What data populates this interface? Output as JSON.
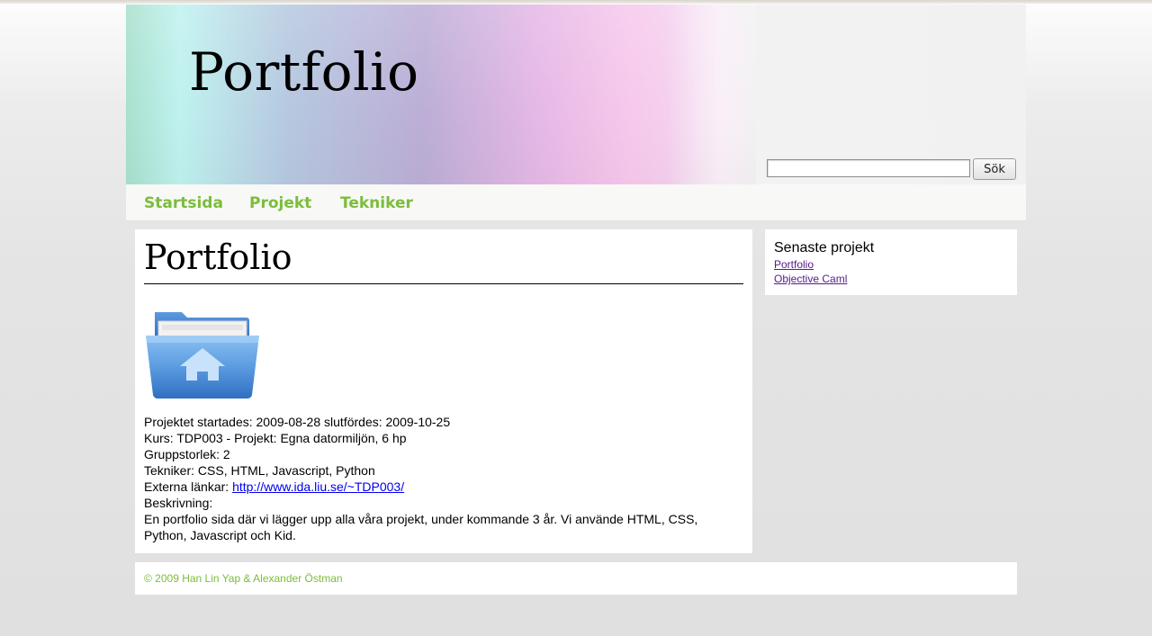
{
  "header": {
    "title": "Portfolio",
    "search": {
      "value": "",
      "placeholder": ""
    },
    "search_button": "Sök"
  },
  "nav": {
    "items": [
      {
        "label": "Startsida"
      },
      {
        "label": "Projekt"
      },
      {
        "label": "Tekniker"
      }
    ]
  },
  "main": {
    "heading": "Portfolio",
    "image_icon": "folder-home-icon",
    "info": {
      "started_label": "Projektet startades:",
      "started": "2009-08-28",
      "finished_label": "slutfördes:",
      "finished": "2009-10-25",
      "course": "Kurs: TDP003 - Projekt: Egna datormiljön, 6 hp",
      "group_size": "Gruppstorlek: 2",
      "techniques": "Tekniker: CSS, HTML, Javascript, Python",
      "external_label": "Externa länkar:",
      "external_link": "http://www.ida.liu.se/~TDP003/",
      "description_label": "Beskrivning:",
      "description": "En portfolio sida där vi lägger upp alla våra projekt, under kommande 3 år. Vi använde HTML, CSS, Python, Javascript och Kid."
    }
  },
  "sidebar": {
    "title": "Senaste projekt",
    "links": [
      {
        "label": "Portfolio"
      },
      {
        "label": "Objective Caml"
      }
    ]
  },
  "footer": {
    "text": "© 2009 Han Lin Yap & Alexander Östman"
  },
  "colors": {
    "nav_link": "#7bbd3a",
    "footer_text": "#7bbd3a",
    "visited_link": "#551a8b",
    "link": "#0000ee"
  }
}
